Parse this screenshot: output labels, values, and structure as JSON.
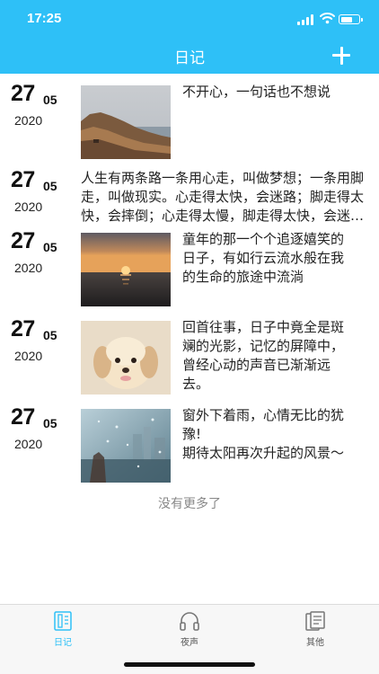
{
  "status_bar": {
    "time": "17:25"
  },
  "header": {
    "title": "日记"
  },
  "entries": [
    {
      "day": "27",
      "month": "05",
      "year": "2020",
      "image": "rocky-coast",
      "text": "不开心，一句话也不想说"
    },
    {
      "day": "27",
      "month": "05",
      "year": "2020",
      "image": "",
      "text": "人生有两条路一条用心走，叫做梦想；一条用脚走，叫做现实。心走得太快，会迷路；脚走得太快，会摔倒；心走得太慢，脚走得太快，会迷失。"
    },
    {
      "day": "27",
      "month": "05",
      "year": "2020",
      "image": "sunset-sea",
      "text": "童年的那一个个追逐嬉笑的日子，有如行云流水般在我的生命的旅途中流淌"
    },
    {
      "day": "27",
      "month": "05",
      "year": "2020",
      "image": "puppy",
      "text": "回首往事，日子中竟全是斑斓的光影，记忆的屏障中，曾经心动的声音已渐渐远去。"
    },
    {
      "day": "27",
      "month": "05",
      "year": "2020",
      "image": "rainy-window",
      "text": "窗外下着雨，心情无比的犹豫!\n期待太阳再次升起的风景～"
    }
  ],
  "footer_text": "没有更多了",
  "tabs": [
    {
      "label": "日记",
      "icon": "diary-icon",
      "active": true
    },
    {
      "label": "夜声",
      "icon": "headphones-icon",
      "active": false
    },
    {
      "label": "其他",
      "icon": "documents-icon",
      "active": false
    }
  ],
  "colors": {
    "accent": "#2ec0f7",
    "tab_inactive": "#555555"
  }
}
